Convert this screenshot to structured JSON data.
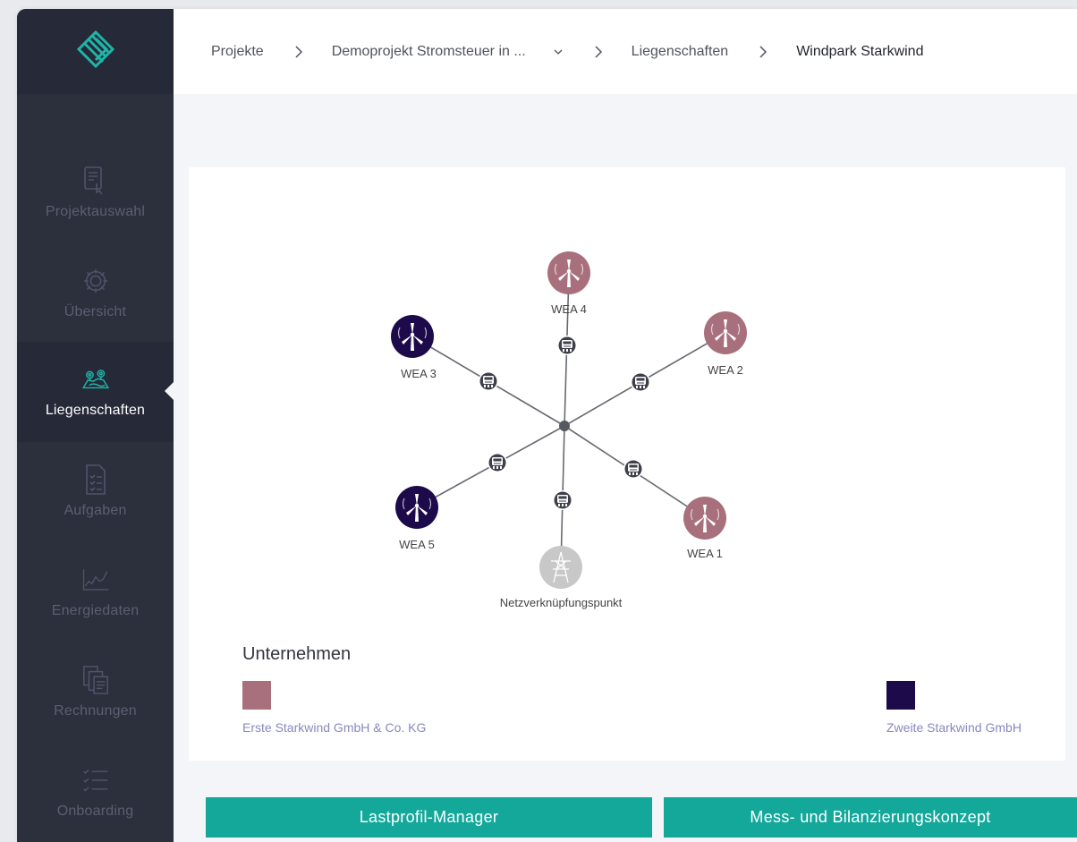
{
  "breadcrumb": {
    "items": [
      "Projekte",
      "Demoprojekt Stromsteuer in ...",
      "Liegenschaften",
      "Windpark Starkwind"
    ]
  },
  "sidebar": {
    "items": [
      {
        "label": "Projektauswahl",
        "icon": "project-select-icon",
        "active": false
      },
      {
        "label": "Übersicht",
        "icon": "gear-icon",
        "active": false
      },
      {
        "label": "Liegenschaften",
        "icon": "properties-icon",
        "active": true
      },
      {
        "label": "Aufgaben",
        "icon": "tasks-icon",
        "active": false
      },
      {
        "label": "Energiedaten",
        "icon": "energy-chart-icon",
        "active": false
      },
      {
        "label": "Rechnungen",
        "icon": "invoices-icon",
        "active": false
      },
      {
        "label": "Onboarding",
        "icon": "checklist-icon",
        "active": false
      }
    ]
  },
  "graph": {
    "nodes": [
      {
        "id": "wea4",
        "label": "WEA 4",
        "type": "wind-turbine",
        "owner": "Erste Starkwind GmbH & Co. KG"
      },
      {
        "id": "wea2",
        "label": "WEA 2",
        "type": "wind-turbine",
        "owner": "Erste Starkwind GmbH & Co. KG"
      },
      {
        "id": "wea3",
        "label": "WEA 3",
        "type": "wind-turbine",
        "owner": "Zweite Starkwind GmbH"
      },
      {
        "id": "wea5",
        "label": "WEA 5",
        "type": "wind-turbine",
        "owner": "Zweite Starkwind GmbH"
      },
      {
        "id": "wea1",
        "label": "WEA 1",
        "type": "wind-turbine",
        "owner": "Erste Starkwind GmbH & Co. KG"
      },
      {
        "id": "nvp",
        "label": "Netzverknüpfungspunkt",
        "type": "grid-connection"
      }
    ],
    "meter_icon": "meter-icon"
  },
  "legend": {
    "title": "Unternehmen",
    "companies": [
      {
        "name": "Erste Starkwind GmbH & Co. KG",
        "color": "#a86f7c"
      },
      {
        "name": "Zweite Starkwind GmbH",
        "color": "#1c0a4a"
      }
    ]
  },
  "colors": {
    "sidebar": "#2c2f3c",
    "accent": "#14a89b",
    "grid_node": "#c8c8c8"
  },
  "buttons": {
    "load_profile": "Lastprofil-Manager",
    "metering_concept": "Mess- und Bilanzierungskonzept"
  }
}
